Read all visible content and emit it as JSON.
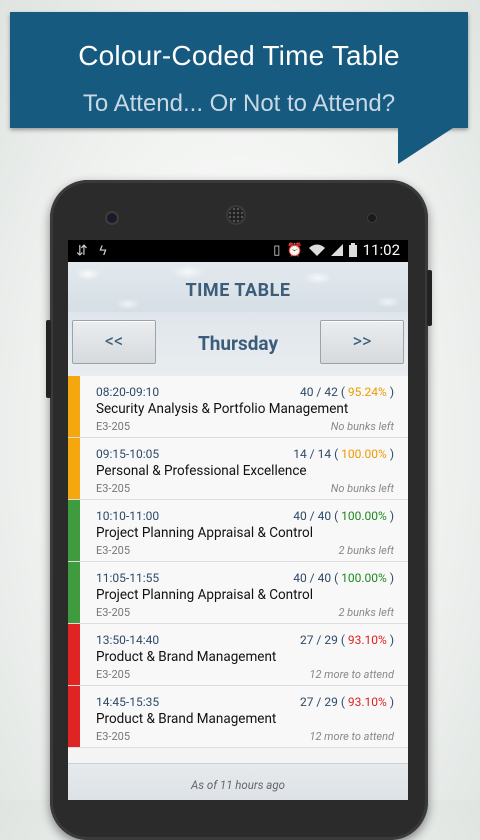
{
  "banner": {
    "title": "Colour-Coded Time Table",
    "subtitle": "To Attend... Or Not to Attend?",
    "color": "#165a80"
  },
  "status_bar": {
    "left_icons": [
      "usb-icon",
      "charging-icon"
    ],
    "right_icons": [
      "vibrate-icon",
      "alarm-icon",
      "wifi-icon",
      "signal-icon",
      "battery-icon"
    ],
    "time": "11:02"
  },
  "screen": {
    "title": "TIME TABLE",
    "prev_label": "<<",
    "next_label": ">>",
    "day": "Thursday"
  },
  "colors": {
    "orange": "#f5a70f",
    "green": "#3e9b3e",
    "red": "#e02424",
    "pct_orange": "#f09a00",
    "pct_green": "#1f8a1f",
    "pct_red": "#e02020"
  },
  "classes": [
    {
      "time": "08:20-09:10",
      "attended": "40 / 42",
      "percent": "95.24%",
      "subject": "Security Analysis & Portfolio Management",
      "room": "E3-205",
      "note": "No bunks left",
      "status": "orange"
    },
    {
      "time": "09:15-10:05",
      "attended": "14 / 14",
      "percent": "100.00%",
      "subject": "Personal & Professional Excellence",
      "room": "E3-205",
      "note": "No bunks left",
      "status": "orange"
    },
    {
      "time": "10:10-11:00",
      "attended": "40 / 40",
      "percent": "100.00%",
      "subject": "Project Planning Appraisal & Control",
      "room": "E3-205",
      "note": "2 bunks left",
      "status": "green"
    },
    {
      "time": "11:05-11:55",
      "attended": "40 / 40",
      "percent": "100.00%",
      "subject": "Project Planning Appraisal & Control",
      "room": "E3-205",
      "note": "2 bunks left",
      "status": "green"
    },
    {
      "time": "13:50-14:40",
      "attended": "27 / 29",
      "percent": "93.10%",
      "subject": "Product & Brand Management",
      "room": "E3-205",
      "note": "12 more to attend",
      "status": "red"
    },
    {
      "time": "14:45-15:35",
      "attended": "27 / 29",
      "percent": "93.10%",
      "subject": "Product & Brand Management",
      "room": "E3-205",
      "note": "12 more to attend",
      "status": "red"
    }
  ],
  "footer": {
    "text": "As of 11 hours ago"
  }
}
